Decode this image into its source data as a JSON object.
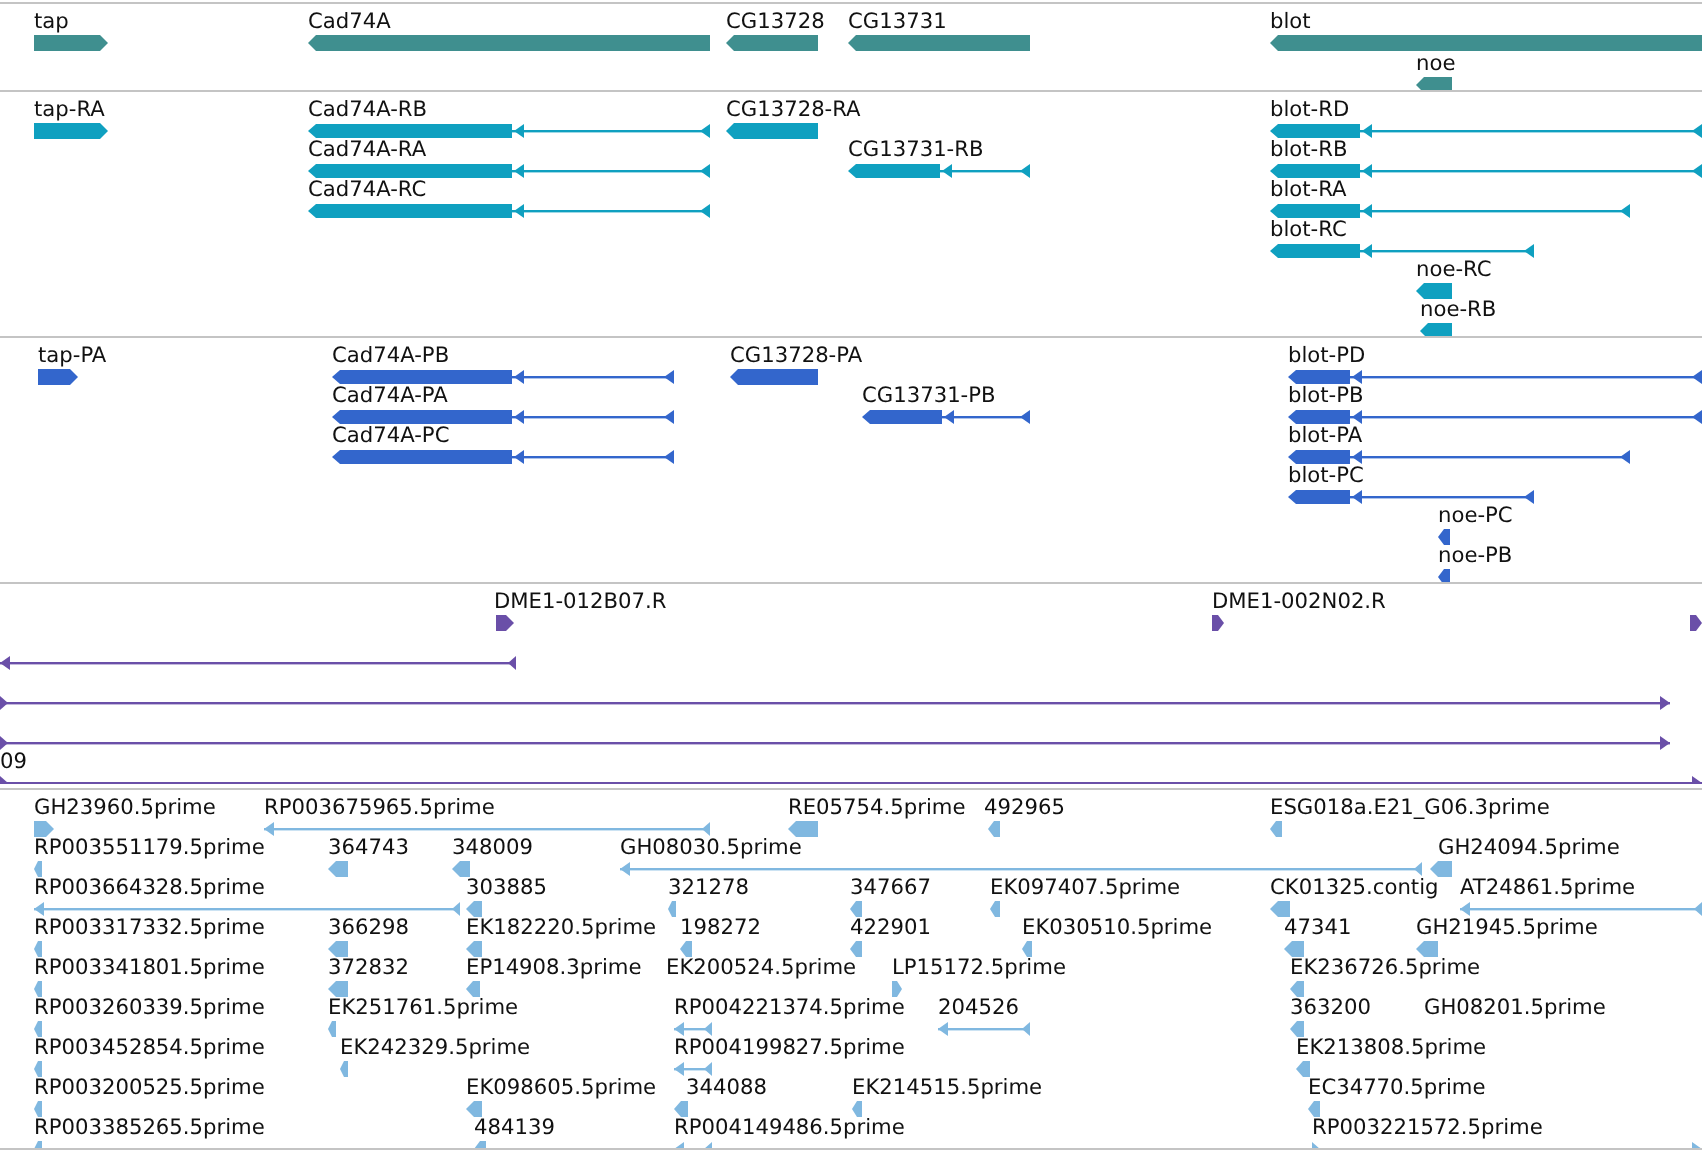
{
  "tracks": [
    {
      "kind": "gene",
      "features": [
        {
          "label": "tap",
          "reverse": false
        },
        {
          "label": "Cad74A",
          "reverse": true
        },
        {
          "label": "CG13728",
          "reverse": true
        },
        {
          "label": "CG13731",
          "reverse": true
        },
        {
          "label": "blot",
          "reverse": true
        },
        {
          "label": "noe",
          "reverse": true
        }
      ]
    },
    {
      "kind": "transcript",
      "features": [
        {
          "label": "tap-RA",
          "reverse": false
        },
        {
          "label": "Cad74A-RB",
          "reverse": true
        },
        {
          "label": "Cad74A-RA",
          "reverse": true
        },
        {
          "label": "Cad74A-RC",
          "reverse": true
        },
        {
          "label": "CG13728-RA",
          "reverse": true
        },
        {
          "label": "CG13731-RB",
          "reverse": true
        },
        {
          "label": "blot-RD",
          "reverse": true
        },
        {
          "label": "blot-RB",
          "reverse": true
        },
        {
          "label": "blot-RA",
          "reverse": true
        },
        {
          "label": "blot-RC",
          "reverse": true
        },
        {
          "label": "noe-RC",
          "reverse": true
        },
        {
          "label": "noe-RB",
          "reverse": true
        }
      ]
    },
    {
      "kind": "protein",
      "features": [
        {
          "label": "tap-PA",
          "reverse": false
        },
        {
          "label": "Cad74A-PB",
          "reverse": true
        },
        {
          "label": "Cad74A-PA",
          "reverse": true
        },
        {
          "label": "Cad74A-PC",
          "reverse": true
        },
        {
          "label": "CG13728-PA",
          "reverse": true
        },
        {
          "label": "CG13731-PB",
          "reverse": true
        },
        {
          "label": "blot-PD",
          "reverse": true
        },
        {
          "label": "blot-PB",
          "reverse": true
        },
        {
          "label": "blot-PA",
          "reverse": true
        },
        {
          "label": "blot-PC",
          "reverse": true
        },
        {
          "label": "noe-PC",
          "reverse": true
        },
        {
          "label": "noe-PB",
          "reverse": true
        }
      ]
    },
    {
      "kind": "clone",
      "features": [
        {
          "label": "DME1-012B07.R",
          "reverse": false
        },
        {
          "label": "DME1-002N02.R",
          "reverse": false
        },
        {
          "reverse": false
        },
        {
          "reverse": true
        },
        {
          "reverse": false
        },
        {
          "reverse": false
        },
        {
          "label": "09",
          "reverse": false
        }
      ]
    },
    {
      "kind": "est",
      "features": [
        {
          "label": "GH23960.5prime",
          "reverse": false
        },
        {
          "label": "RP003675965.5prime",
          "reverse": true
        },
        {
          "label": "RE05754.5prime",
          "reverse": true
        },
        {
          "label": "492965",
          "reverse": true
        },
        {
          "label": "ESG018a.E21_G06.3prime",
          "reverse": true
        },
        {
          "label": "RP003551179.5prime",
          "reverse": true
        },
        {
          "label": "364743",
          "reverse": true
        },
        {
          "label": "348009",
          "reverse": true
        },
        {
          "label": "GH08030.5prime",
          "reverse": true
        },
        {
          "label": "GH24094.5prime",
          "reverse": true
        },
        {
          "label": "RP003664328.5prime",
          "reverse": true
        },
        {
          "label": "303885",
          "reverse": true
        },
        {
          "label": "321278",
          "reverse": true
        },
        {
          "label": "347667",
          "reverse": true
        },
        {
          "label": "EK097407.5prime",
          "reverse": true
        },
        {
          "label": "CK01325.contig",
          "reverse": true
        },
        {
          "label": "AT24861.5prime",
          "reverse": true
        },
        {
          "label": "RP003317332.5prime",
          "reverse": true
        },
        {
          "label": "366298",
          "reverse": true
        },
        {
          "label": "EK182220.5prime",
          "reverse": true
        },
        {
          "label": "198272",
          "reverse": true
        },
        {
          "label": "422901",
          "reverse": true
        },
        {
          "label": "EK030510.5prime",
          "reverse": true
        },
        {
          "label": "47341",
          "reverse": true
        },
        {
          "label": "GH21945.5prime",
          "reverse": true
        },
        {
          "label": "RP003341801.5prime",
          "reverse": true
        },
        {
          "label": "372832",
          "reverse": true
        },
        {
          "label": "EP14908.3prime",
          "reverse": true
        },
        {
          "label": "EK200524.5prime"
        },
        {
          "label": "LP15172.5prime",
          "reverse": false
        },
        {
          "label": "EK236726.5prime",
          "reverse": true
        },
        {
          "label": "RP003260339.5prime",
          "reverse": true
        },
        {
          "label": "EK251761.5prime",
          "reverse": true
        },
        {
          "label": "RP004221374.5prime",
          "reverse": true
        },
        {
          "label": "204526",
          "reverse": true
        },
        {
          "label": "363200",
          "reverse": true
        },
        {
          "label": "GH08201.5prime"
        },
        {
          "label": "RP003452854.5prime",
          "reverse": true
        },
        {
          "label": "EK242329.5prime",
          "reverse": true
        },
        {
          "label": "RP004199827.5prime",
          "reverse": true
        },
        {
          "label": "EK213808.5prime",
          "reverse": true
        },
        {
          "label": "RP003200525.5prime",
          "reverse": true
        },
        {
          "label": "EK098605.5prime",
          "reverse": true
        },
        {
          "label": "344088",
          "reverse": true
        },
        {
          "label": "EK214515.5prime",
          "reverse": true
        },
        {
          "label": "EC34770.5prime",
          "reverse": true
        },
        {
          "label": "RP003385265.5prime",
          "reverse": true
        },
        {
          "label": "484139",
          "reverse": true
        },
        {
          "label": "RP004149486.5prime",
          "reverse": true
        },
        {
          "label": "RP003221572.5prime",
          "reverse": false
        }
      ]
    }
  ]
}
